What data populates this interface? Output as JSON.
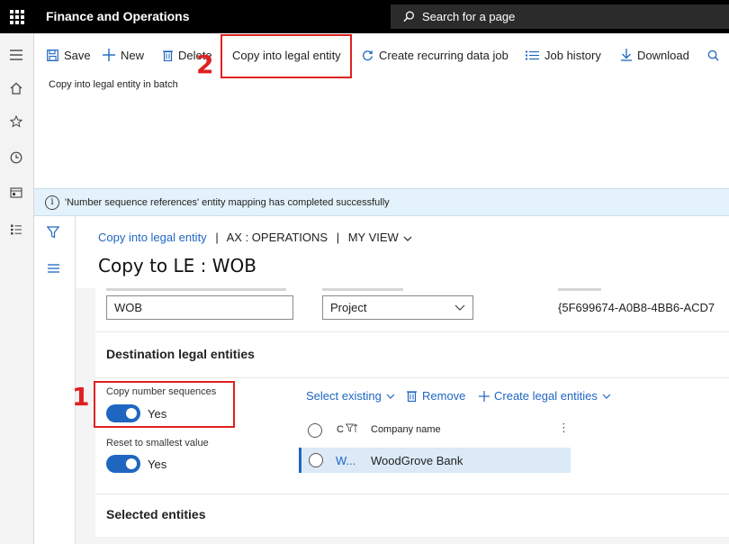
{
  "app": {
    "title": "Finance and Operations",
    "search_placeholder": "Search for a page"
  },
  "toolbar": {
    "save": "Save",
    "new": "New",
    "delete": "Delete",
    "copy_into_legal_entity": "Copy into legal entity",
    "create_recurring_data_job": "Create recurring data job",
    "job_history": "Job history",
    "download": "Download",
    "sublabel": "Copy into legal entity in batch"
  },
  "message": "'Number sequence references' entity mapping has completed successfully",
  "breadcrumb": {
    "link": "Copy into legal entity",
    "sep1": "|",
    "company": "AX : OPERATIONS",
    "sep2": "|",
    "view": "MY VIEW"
  },
  "page_title": "Copy to LE : WOB",
  "fields": {
    "description_value": "WOB",
    "project_category_value": "Project",
    "group_id_value": "{5F699674-A0B8-4BB6-ACD7"
  },
  "destination": {
    "title": "Destination legal entities",
    "copy_number_sequences_label": "Copy number sequences",
    "copy_number_sequences_value": "Yes",
    "reset_smallest_label": "Reset to smallest value",
    "reset_smallest_value": "Yes",
    "select_existing": "Select existing",
    "remove": "Remove",
    "create_legal_entities": "Create legal entities",
    "grid": {
      "col_company": "C",
      "col_company_name": "Company name",
      "rows": [
        {
          "company": "W...",
          "company_name": "WoodGrove Bank"
        }
      ]
    }
  },
  "selected_entities_title": "Selected entities",
  "annotations": {
    "one": "1",
    "two": "2"
  },
  "colors": {
    "accent": "#1f66c1",
    "annotation": "#e02020",
    "topbar": "#000000",
    "message_bg": "#e4f2fb"
  }
}
